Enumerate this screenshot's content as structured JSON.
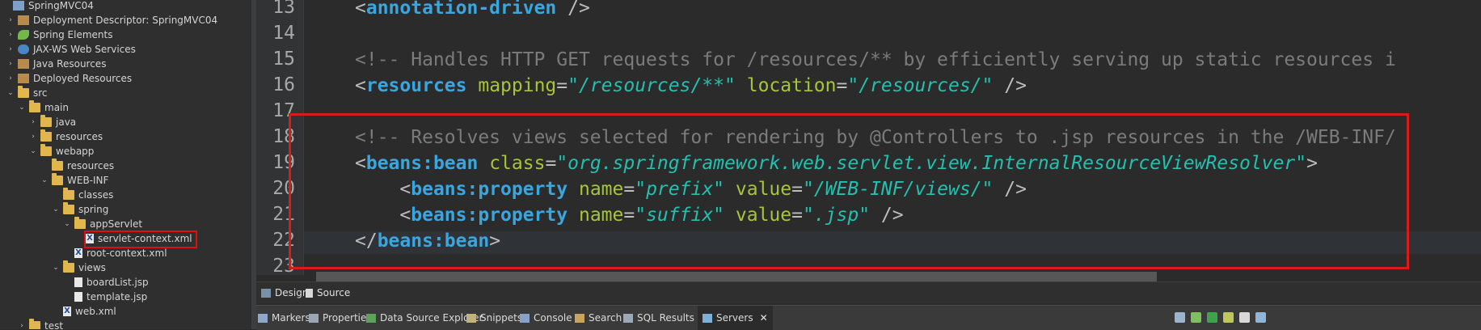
{
  "explorer": {
    "items": [
      {
        "label": "SpringMVC04",
        "icon": "project-icon",
        "arrow": "",
        "expanded": true
      },
      {
        "label": "Deployment Descriptor: SpringMVC04",
        "icon": "deployment-descriptor-icon",
        "arrow": "›"
      },
      {
        "label": "Spring Elements",
        "icon": "spring-leaf-icon",
        "arrow": "›"
      },
      {
        "label": "JAX-WS Web Services",
        "icon": "web-services-icon",
        "arrow": "›"
      },
      {
        "label": "Java Resources",
        "icon": "java-resources-icon",
        "arrow": "›"
      },
      {
        "label": "Deployed Resources",
        "icon": "deployed-resources-icon",
        "arrow": "›"
      },
      {
        "label": "src",
        "icon": "folder-icon",
        "arrow": "⌄"
      },
      {
        "label": "main",
        "icon": "folder-icon",
        "arrow": "⌄"
      },
      {
        "label": "java",
        "icon": "folder-icon",
        "arrow": "›"
      },
      {
        "label": "resources",
        "icon": "folder-icon",
        "arrow": "›"
      },
      {
        "label": "webapp",
        "icon": "folder-icon",
        "arrow": "⌄"
      },
      {
        "label": "resources",
        "icon": "folder-icon",
        "arrow": ""
      },
      {
        "label": "WEB-INF",
        "icon": "folder-icon",
        "arrow": "⌄"
      },
      {
        "label": "classes",
        "icon": "folder-icon",
        "arrow": ""
      },
      {
        "label": "spring",
        "icon": "folder-icon",
        "arrow": "⌄"
      },
      {
        "label": "appServlet",
        "icon": "folder-icon",
        "arrow": "⌄"
      },
      {
        "label": "servlet-context.xml",
        "icon": "xml-file-icon",
        "arrow": "",
        "selected": true
      },
      {
        "label": "root-context.xml",
        "icon": "xml-file-icon",
        "arrow": ""
      },
      {
        "label": "views",
        "icon": "folder-icon",
        "arrow": "⌄"
      },
      {
        "label": "boardList.jsp",
        "icon": "jsp-file-icon",
        "arrow": ""
      },
      {
        "label": "template.jsp",
        "icon": "jsp-file-icon",
        "arrow": ""
      },
      {
        "label": "web.xml",
        "icon": "xml-file-icon",
        "arrow": ""
      },
      {
        "label": "test",
        "icon": "folder-icon",
        "arrow": "›"
      }
    ]
  },
  "editor": {
    "lines": [
      {
        "num": "13",
        "parts": [
          [
            "br",
            "<"
          ],
          [
            "tag",
            "annotation-driven"
          ],
          [
            "br",
            " />"
          ]
        ]
      },
      {
        "num": "14",
        "parts": []
      },
      {
        "num": "15",
        "parts": [
          [
            "com",
            "<!-- Handles HTTP GET requests for /resources/** by efficiently serving up static resources i"
          ]
        ]
      },
      {
        "num": "16",
        "parts": [
          [
            "br",
            "<"
          ],
          [
            "tag",
            "resources"
          ],
          [
            "txt",
            " "
          ],
          [
            "attr",
            "mapping"
          ],
          [
            "br",
            "="
          ],
          [
            "val",
            "\"/resources/**\""
          ],
          [
            "txt",
            " "
          ],
          [
            "attr",
            "location"
          ],
          [
            "br",
            "="
          ],
          [
            "val",
            "\"/resources/\""
          ],
          [
            "br",
            " />"
          ]
        ]
      },
      {
        "num": "17",
        "parts": []
      },
      {
        "num": "18",
        "parts": [
          [
            "com",
            "<!-- Resolves views selected for rendering by @Controllers to .jsp resources in the /WEB-INF/"
          ]
        ]
      },
      {
        "num": "19",
        "parts": [
          [
            "br",
            "<"
          ],
          [
            "tag",
            "beans:bean"
          ],
          [
            "txt",
            " "
          ],
          [
            "attr",
            "class"
          ],
          [
            "br",
            "="
          ],
          [
            "val",
            "\"org.springframework.web.servlet.view.InternalResourceViewResolver\""
          ],
          [
            "br",
            ">"
          ]
        ]
      },
      {
        "num": "20",
        "parts": [
          [
            "txt",
            "    "
          ],
          [
            "br",
            "<"
          ],
          [
            "tag",
            "beans:property"
          ],
          [
            "txt",
            " "
          ],
          [
            "attr",
            "name"
          ],
          [
            "br",
            "="
          ],
          [
            "val",
            "\"prefix\""
          ],
          [
            "txt",
            " "
          ],
          [
            "attr",
            "value"
          ],
          [
            "br",
            "="
          ],
          [
            "val",
            "\"/WEB-INF/views/\""
          ],
          [
            "br",
            " />"
          ]
        ]
      },
      {
        "num": "21",
        "parts": [
          [
            "txt",
            "    "
          ],
          [
            "br",
            "<"
          ],
          [
            "tag",
            "beans:property"
          ],
          [
            "txt",
            " "
          ],
          [
            "attr",
            "name"
          ],
          [
            "br",
            "="
          ],
          [
            "val",
            "\"suffix\""
          ],
          [
            "txt",
            " "
          ],
          [
            "attr",
            "value"
          ],
          [
            "br",
            "="
          ],
          [
            "val",
            "\".jsp\""
          ],
          [
            "br",
            " />"
          ]
        ]
      },
      {
        "num": "22",
        "parts": [
          [
            "br",
            "</"
          ],
          [
            "tag",
            "beans:bean"
          ],
          [
            "br",
            ">"
          ]
        ]
      },
      {
        "num": "23",
        "parts": []
      }
    ]
  },
  "design_source_tabs": {
    "design": "Design",
    "source": "Source"
  },
  "views": {
    "tabs": [
      {
        "label": "Markers",
        "icon": "markers-icon"
      },
      {
        "label": "Properties",
        "icon": "properties-icon"
      },
      {
        "label": "Data Source Explorer",
        "icon": "data-source-explorer-icon"
      },
      {
        "label": "Snippets",
        "icon": "snippets-icon"
      },
      {
        "label": "Console",
        "icon": "console-icon"
      },
      {
        "label": "Search",
        "icon": "search-icon"
      },
      {
        "label": "SQL Results",
        "icon": "sql-results-icon"
      },
      {
        "label": "Servers",
        "icon": "servers-icon",
        "active": true
      }
    ],
    "close_label": "✕"
  },
  "colors": {
    "highlight_red": "#d81b1b",
    "tag_blue": "#3aa6e0",
    "attr_green": "#a6c63a",
    "value_teal": "#23c0b0",
    "comment_gray": "#7b7b7b"
  }
}
